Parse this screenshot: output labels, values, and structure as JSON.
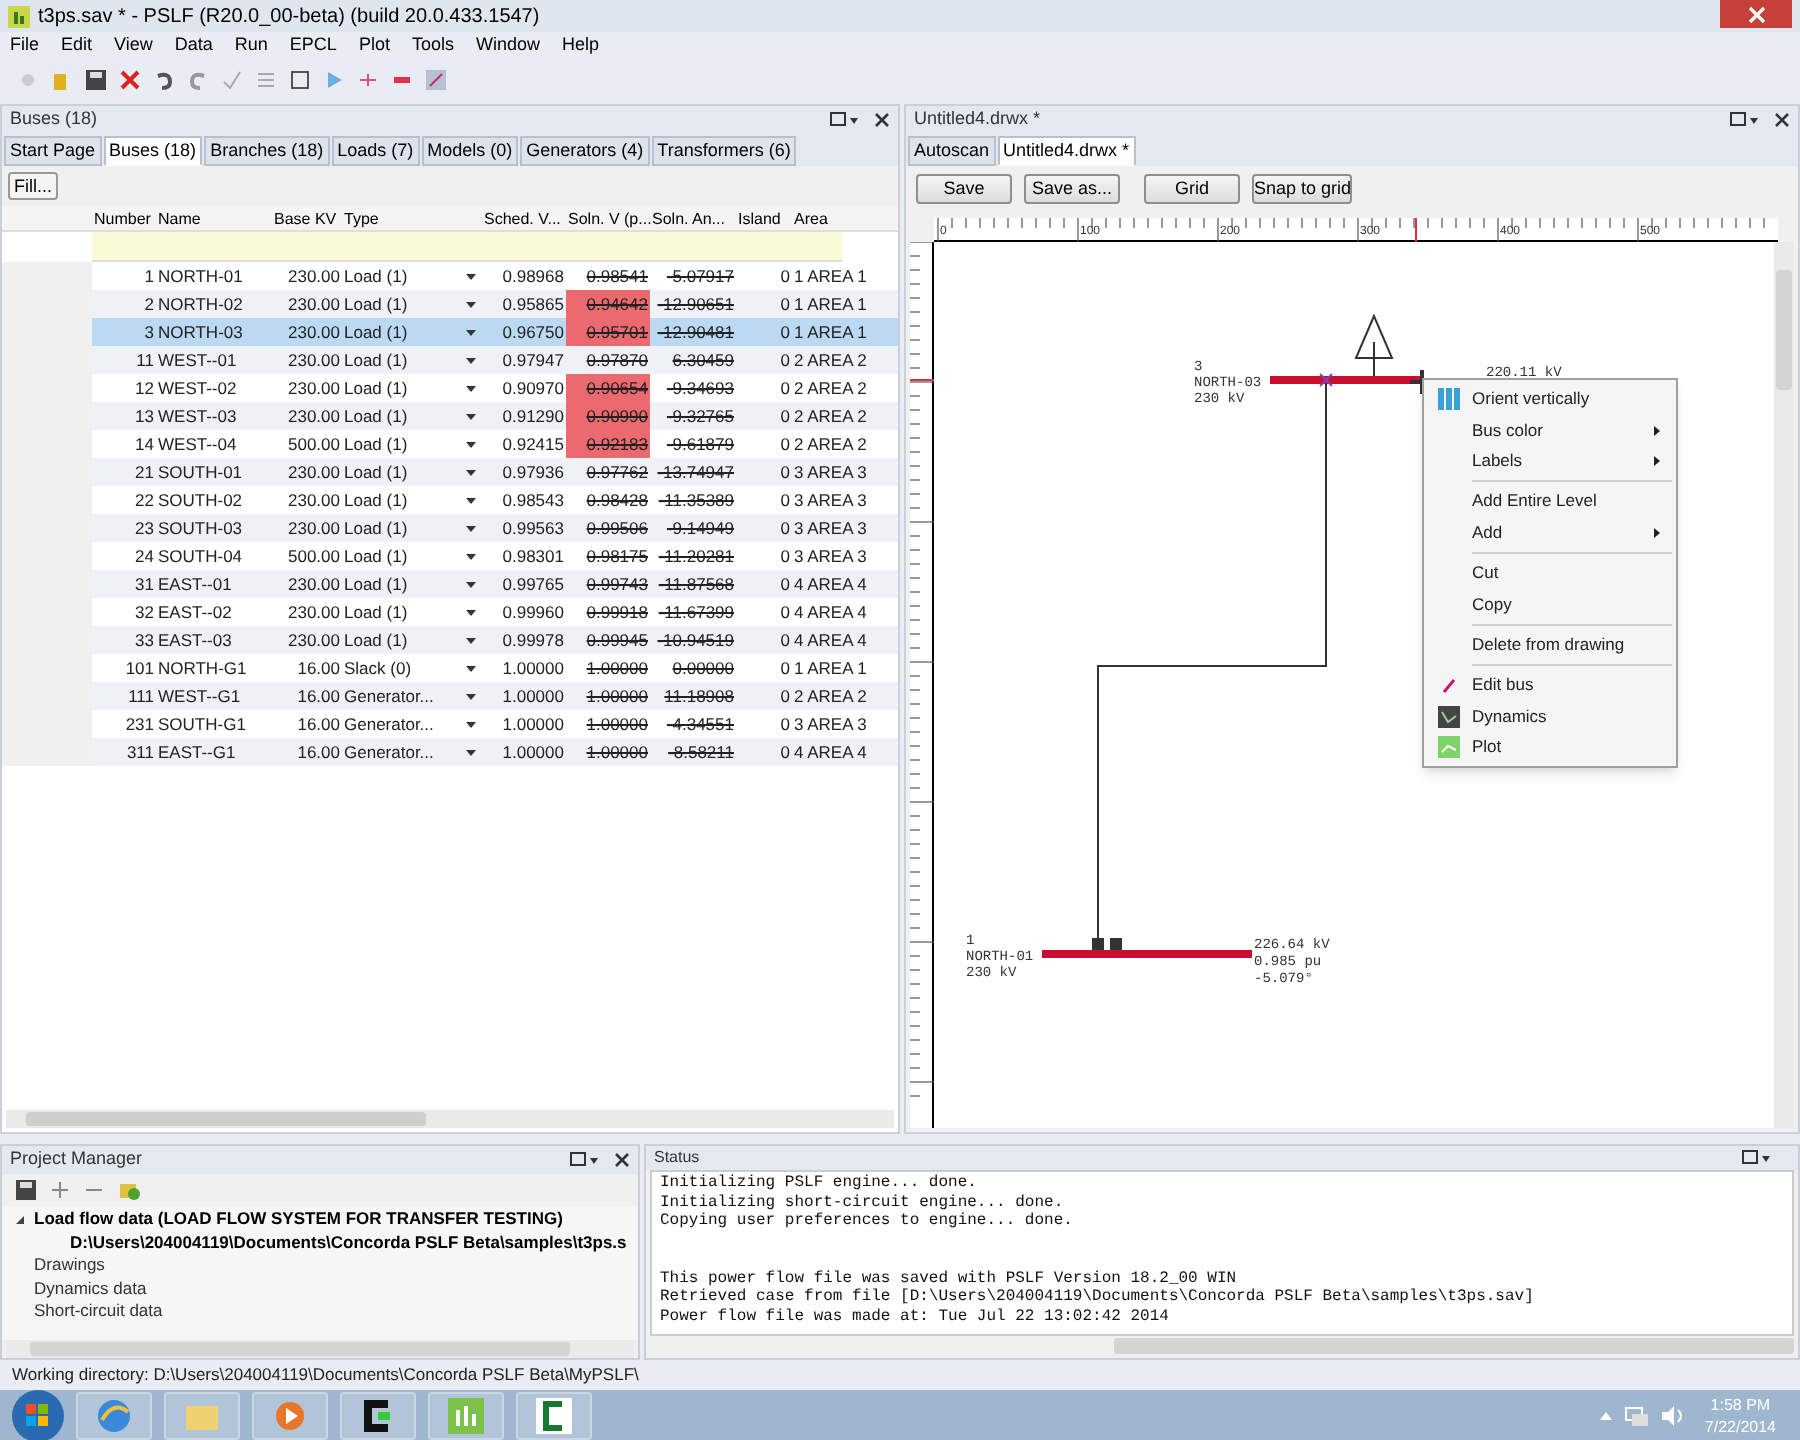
{
  "window": {
    "title": "t3ps.sav * - PSLF (R20.0_00-beta) (build 20.0.433.1547)"
  },
  "menu": [
    "File",
    "Edit",
    "View",
    "Data",
    "Run",
    "EPCL",
    "Plot",
    "Tools",
    "Window",
    "Help"
  ],
  "bus_panel": {
    "title": "Buses (18)",
    "tabs": [
      {
        "label": "Start Page",
        "selected": false
      },
      {
        "label": "Buses (18)",
        "selected": true
      },
      {
        "label": "Branches (18)",
        "selected": false
      },
      {
        "label": "Loads (7)",
        "selected": false
      },
      {
        "label": "Models (0)",
        "selected": false
      },
      {
        "label": "Generators (4)",
        "selected": false
      },
      {
        "label": "Transformers (6)",
        "selected": false
      }
    ],
    "fill_button": "Fill...",
    "columns": [
      "Number",
      "Name",
      "Base KV",
      "Type",
      "Sched. V...",
      "Soln. V (p...",
      "Soln. An...",
      "Island",
      "Area"
    ],
    "rows": [
      {
        "number": "1",
        "name": "NORTH-01",
        "base_kv": "230.00",
        "type": "Load (1)",
        "sched_v": "0.98968",
        "soln_v": "0.98541",
        "soln_angle": "-5.07917",
        "island": "0",
        "area": "1 AREA 1",
        "flagged": false,
        "selected": false
      },
      {
        "number": "2",
        "name": "NORTH-02",
        "base_kv": "230.00",
        "type": "Load (1)",
        "sched_v": "0.95865",
        "soln_v": "0.94642",
        "soln_angle": "-12.90651",
        "island": "0",
        "area": "1 AREA 1",
        "flagged": true,
        "selected": false
      },
      {
        "number": "3",
        "name": "NORTH-03",
        "base_kv": "230.00",
        "type": "Load (1)",
        "sched_v": "0.96750",
        "soln_v": "0.95701",
        "soln_angle": "-12.90481",
        "island": "0",
        "area": "1 AREA 1",
        "flagged": true,
        "selected": true
      },
      {
        "number": "11",
        "name": "WEST--01",
        "base_kv": "230.00",
        "type": "Load (1)",
        "sched_v": "0.97947",
        "soln_v": "0.97870",
        "soln_angle": "6.30459",
        "island": "0",
        "area": "2 AREA 2",
        "flagged": false,
        "selected": false
      },
      {
        "number": "12",
        "name": "WEST--02",
        "base_kv": "230.00",
        "type": "Load (1)",
        "sched_v": "0.90970",
        "soln_v": "0.90654",
        "soln_angle": "-9.34693",
        "island": "0",
        "area": "2 AREA 2",
        "flagged": true,
        "selected": false
      },
      {
        "number": "13",
        "name": "WEST--03",
        "base_kv": "230.00",
        "type": "Load (1)",
        "sched_v": "0.91290",
        "soln_v": "0.90990",
        "soln_angle": "-9.32765",
        "island": "0",
        "area": "2 AREA 2",
        "flagged": true,
        "selected": false
      },
      {
        "number": "14",
        "name": "WEST--04",
        "base_kv": "500.00",
        "type": "Load (1)",
        "sched_v": "0.92415",
        "soln_v": "0.92183",
        "soln_angle": "-9.61879",
        "island": "0",
        "area": "2 AREA 2",
        "flagged": true,
        "selected": false
      },
      {
        "number": "21",
        "name": "SOUTH-01",
        "base_kv": "230.00",
        "type": "Load (1)",
        "sched_v": "0.97936",
        "soln_v": "0.97762",
        "soln_angle": "-13.74947",
        "island": "0",
        "area": "3 AREA 3",
        "flagged": false,
        "selected": false
      },
      {
        "number": "22",
        "name": "SOUTH-02",
        "base_kv": "230.00",
        "type": "Load (1)",
        "sched_v": "0.98543",
        "soln_v": "0.98428",
        "soln_angle": "-11.35389",
        "island": "0",
        "area": "3 AREA 3",
        "flagged": false,
        "selected": false
      },
      {
        "number": "23",
        "name": "SOUTH-03",
        "base_kv": "230.00",
        "type": "Load (1)",
        "sched_v": "0.99563",
        "soln_v": "0.99506",
        "soln_angle": "-9.14949",
        "island": "0",
        "area": "3 AREA 3",
        "flagged": false,
        "selected": false
      },
      {
        "number": "24",
        "name": "SOUTH-04",
        "base_kv": "500.00",
        "type": "Load (1)",
        "sched_v": "0.98301",
        "soln_v": "0.98175",
        "soln_angle": "-11.20281",
        "island": "0",
        "area": "3 AREA 3",
        "flagged": false,
        "selected": false
      },
      {
        "number": "31",
        "name": "EAST--01",
        "base_kv": "230.00",
        "type": "Load (1)",
        "sched_v": "0.99765",
        "soln_v": "0.99743",
        "soln_angle": "-11.87568",
        "island": "0",
        "area": "4 AREA 4",
        "flagged": false,
        "selected": false
      },
      {
        "number": "32",
        "name": "EAST--02",
        "base_kv": "230.00",
        "type": "Load (1)",
        "sched_v": "0.99960",
        "soln_v": "0.99918",
        "soln_angle": "-11.67399",
        "island": "0",
        "area": "4 AREA 4",
        "flagged": false,
        "selected": false
      },
      {
        "number": "33",
        "name": "EAST--03",
        "base_kv": "230.00",
        "type": "Load (1)",
        "sched_v": "0.99978",
        "soln_v": "0.99945",
        "soln_angle": "-10.94519",
        "island": "0",
        "area": "4 AREA 4",
        "flagged": false,
        "selected": false
      },
      {
        "number": "101",
        "name": "NORTH-G1",
        "base_kv": "16.00",
        "type": "Slack (0)",
        "sched_v": "1.00000",
        "soln_v": "1.00000",
        "soln_angle": "0.00000",
        "island": "0",
        "area": "1 AREA 1",
        "flagged": false,
        "selected": false
      },
      {
        "number": "111",
        "name": "WEST--G1",
        "base_kv": "16.00",
        "type": "Generator...",
        "sched_v": "1.00000",
        "soln_v": "1.00000",
        "soln_angle": "11.18908",
        "island": "0",
        "area": "2 AREA 2",
        "flagged": false,
        "selected": false
      },
      {
        "number": "231",
        "name": "SOUTH-G1",
        "base_kv": "16.00",
        "type": "Generator...",
        "sched_v": "1.00000",
        "soln_v": "1.00000",
        "soln_angle": "-4.34551",
        "island": "0",
        "area": "3 AREA 3",
        "flagged": false,
        "selected": false
      },
      {
        "number": "311",
        "name": "EAST--G1",
        "base_kv": "16.00",
        "type": "Generator...",
        "sched_v": "1.00000",
        "soln_v": "1.00000",
        "soln_angle": "-8.58211",
        "island": "0",
        "area": "4 AREA 4",
        "flagged": false,
        "selected": false
      }
    ]
  },
  "drawing_panel": {
    "title": "Untitled4.drwx *",
    "tabs": [
      {
        "label": "Autoscan",
        "selected": false
      },
      {
        "label": "Untitled4.drwx *",
        "selected": true
      }
    ],
    "buttons": [
      "Save",
      "Save as...",
      "Grid",
      "Snap to grid"
    ],
    "ruler_labels": [
      "0",
      "100",
      "200",
      "300",
      "400",
      "500"
    ],
    "buses": [
      {
        "number": "3",
        "name": "NORTH-03",
        "kv": "230 kV",
        "readings": [
          "220.11 kV"
        ]
      },
      {
        "number": "1",
        "name": "NORTH-01",
        "kv": "230 kV",
        "readings": [
          "226.64 kV",
          "0.985 pu",
          "-5.079°"
        ]
      }
    ]
  },
  "context_menu": {
    "groups": [
      [
        {
          "label": "Orient vertically",
          "kind": "orient",
          "submenu": false
        },
        {
          "label": "Bus color",
          "kind": "plain",
          "submenu": true
        },
        {
          "label": "Labels",
          "kind": "plain",
          "submenu": true
        }
      ],
      [
        {
          "label": "Add Entire Level",
          "kind": "plain",
          "submenu": false
        },
        {
          "label": "Add",
          "kind": "plain",
          "submenu": true
        }
      ],
      [
        {
          "label": "Cut",
          "kind": "plain",
          "submenu": false
        },
        {
          "label": "Copy",
          "kind": "plain",
          "submenu": false
        }
      ],
      [
        {
          "label": "Delete from drawing",
          "kind": "plain",
          "submenu": false
        }
      ],
      [
        {
          "label": "Edit bus",
          "kind": "edit",
          "submenu": false
        },
        {
          "label": "Dynamics",
          "kind": "dynamics",
          "submenu": false
        },
        {
          "label": "Plot",
          "kind": "plot",
          "submenu": false
        }
      ]
    ]
  },
  "project_manager": {
    "title": "Project Manager",
    "tree": [
      {
        "label": "Load flow data (LOAD FLOW SYSTEM FOR TRANSFER TESTING)",
        "active": true,
        "expanded": true,
        "children": [
          {
            "label": "D:\\Users\\204004119\\Documents\\Concorda PSLF Beta\\samples\\t3ps.s",
            "active": true
          }
        ]
      },
      {
        "label": "Drawings",
        "active": false
      },
      {
        "label": "Dynamics data",
        "active": false
      },
      {
        "label": "Short-circuit data",
        "active": false
      }
    ]
  },
  "status": {
    "title": "Status",
    "blocks": [
      [
        "Initializing PSLF engine... done.",
        "Initializing short-circuit engine... done.",
        "Copying user preferences to engine... done."
      ],
      [
        "This power flow file was saved with PSLF Version 18.2_00 WIN",
        "Retrieved case from file [D:\\Users\\204004119\\Documents\\Concorda PSLF Beta\\samples\\t3ps.sav]",
        "Power flow file was made at: Tue Jul 22 13:02:42 2014"
      ]
    ]
  },
  "working_directory": "Working directory: D:\\Users\\204004119\\Documents\\Concorda PSLF Beta\\MyPSLF\\",
  "taskbar": {
    "time": "1:58 PM",
    "date": "7/22/2014"
  }
}
